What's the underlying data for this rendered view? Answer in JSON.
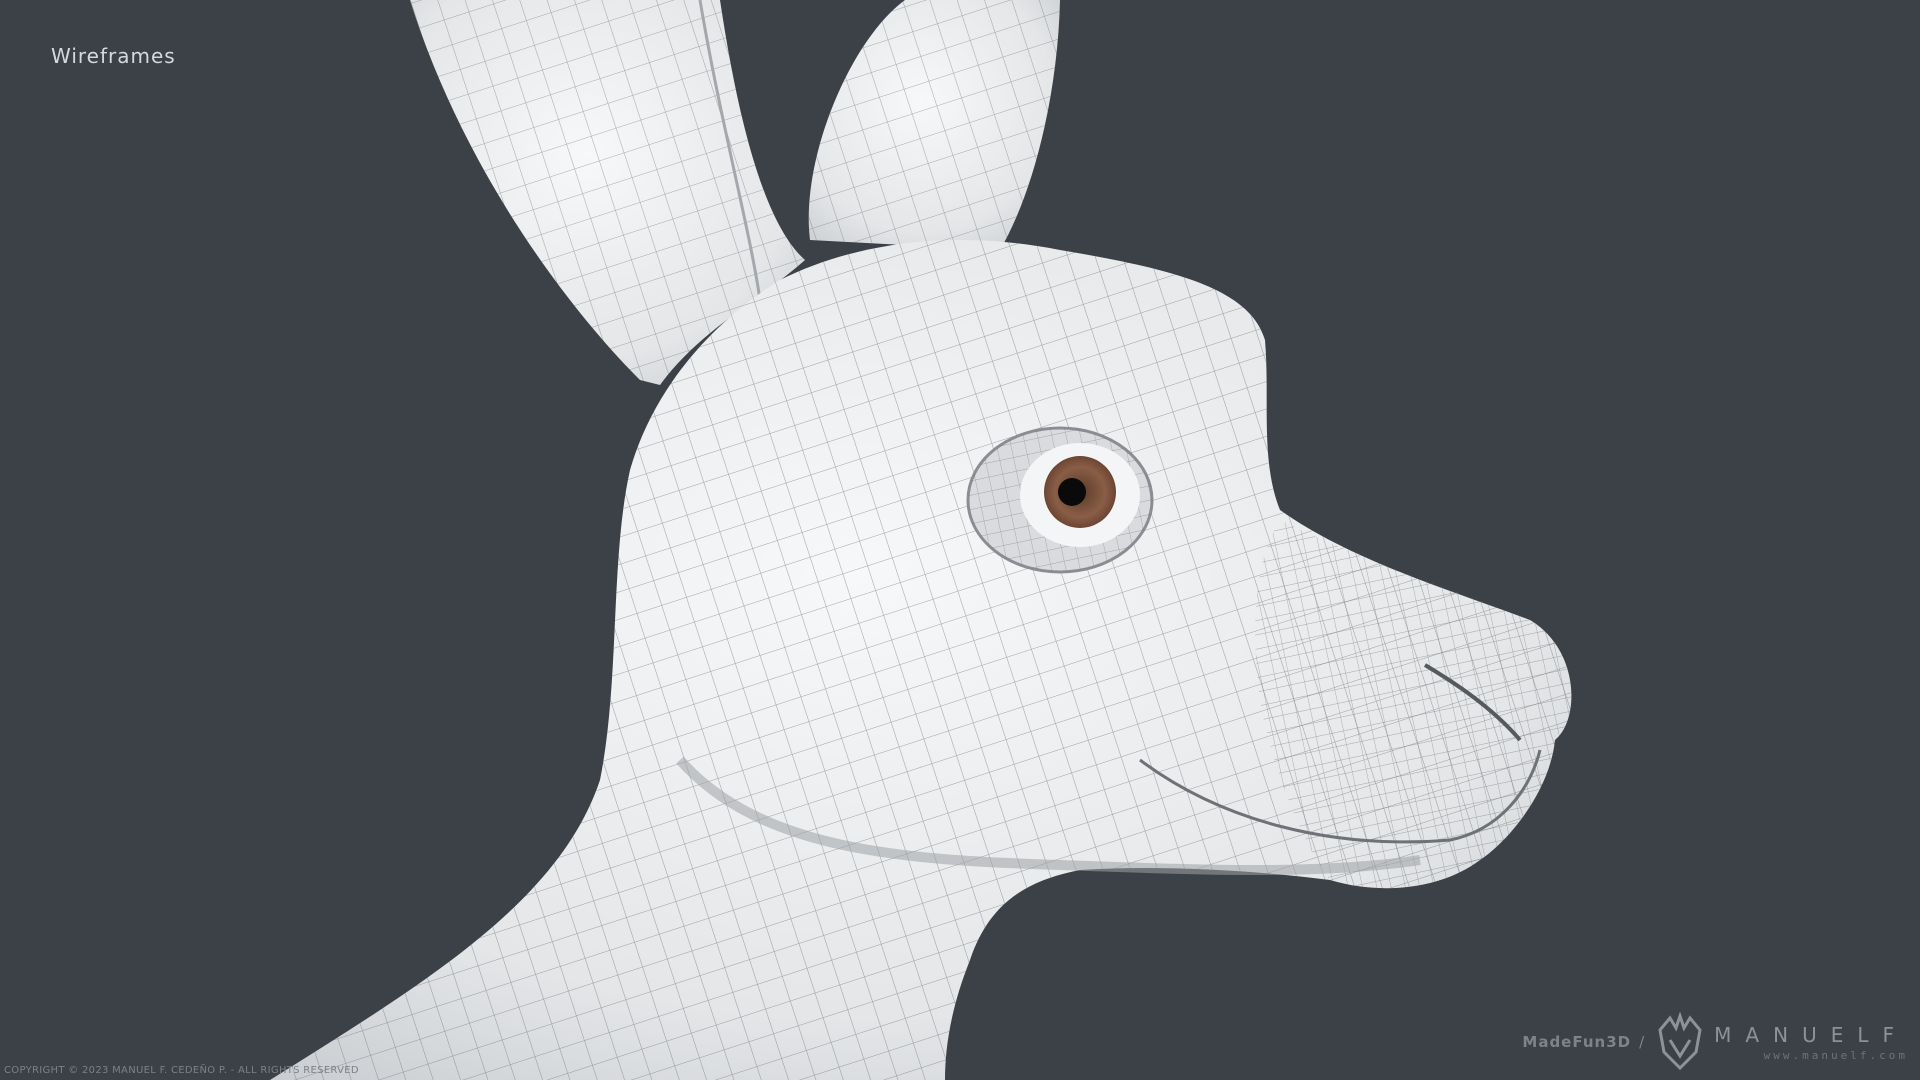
{
  "title": "Wireframes",
  "copyright": "COPYRIGHT © 2023 MANUEL F. CEDEÑO P. - ALL RIGHTS RESERVED",
  "brand": {
    "studio": "MadeFun3D",
    "separator": "/",
    "name": "MANUELF",
    "url": "www.manuelf.com"
  },
  "colors": {
    "background": "#3b4147",
    "mesh_fill": "#eceef0",
    "wire": "#6a6e72",
    "iris": "#8a5e46"
  },
  "subject": "rabbit-head-wireframe-render"
}
